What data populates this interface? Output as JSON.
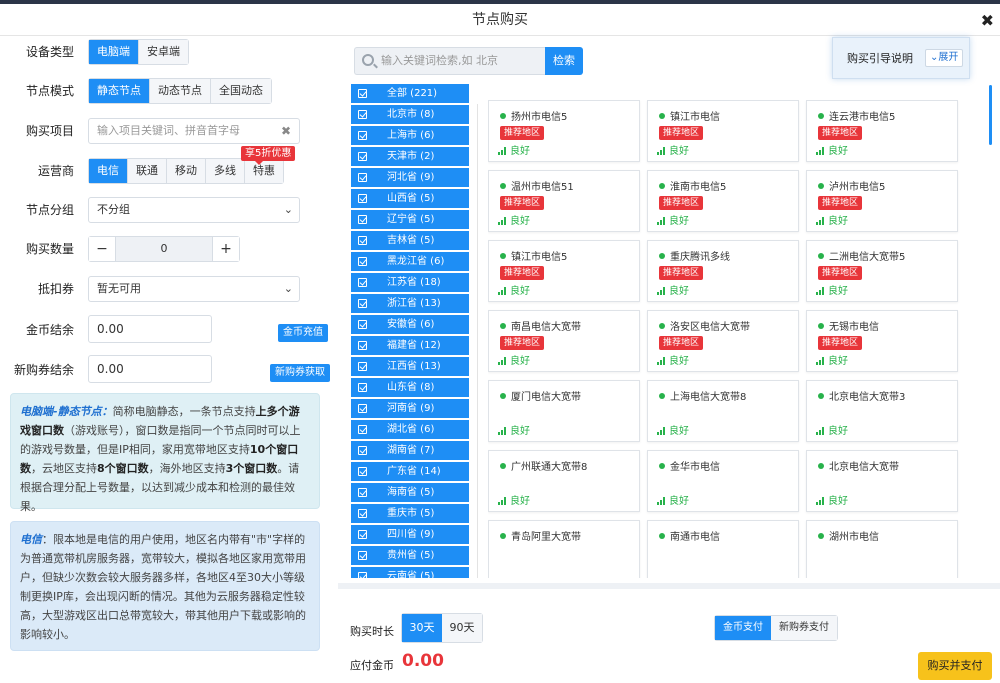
{
  "window": {
    "title": "节点购买"
  },
  "form": {
    "device": {
      "label": "设备类型",
      "options": [
        "电脑端",
        "安卓端"
      ],
      "selected": 0
    },
    "mode": {
      "label": "节点模式",
      "options": [
        "静态节点",
        "动态节点",
        "全国动态"
      ],
      "selected": 0
    },
    "project": {
      "label": "购买项目",
      "placeholder": "输入项目关键词、拼音首字母"
    },
    "carrier": {
      "label": "运营商",
      "options": [
        "电信",
        "联通",
        "移动",
        "多线",
        "特惠"
      ],
      "selected": 0,
      "promo_badge": "享5折优惠"
    },
    "group": {
      "label": "节点分组",
      "value": "不分组"
    },
    "quantity": {
      "label": "购买数量",
      "value": "0",
      "minus": "−",
      "plus": "+"
    },
    "voucher": {
      "label": "抵扣券",
      "value": "暂无可用"
    },
    "coin": {
      "label": "金币结余",
      "value": "0.00",
      "button": "金币充值"
    },
    "newvoucher": {
      "label": "新购券结余",
      "value": "0.00",
      "button": "新购券获取"
    }
  },
  "info": {
    "static": {
      "title": "电脑端-静态节点：",
      "p1": "简称电脑静态，一条节点支持",
      "h1": "上多个游戏窗口数",
      "p2": "（游戏账号），窗口数是指同一个节点同时可以上的游戏号数量，但是IP相同，家用宽带地区支持",
      "h2": "10个窗口数",
      "p3": "，云地区支持",
      "h3": "8个窗口数",
      "p4": "，海外地区支持",
      "h4": "3个窗口数",
      "p5": "。请根据合理分配上号数量，以达到减少成本和检测的最佳效果。"
    },
    "telecom": {
      "title": "电信",
      "text": "：限本地是电信的用户使用，地区名内带有\"市\"字样的为普通宽带机房服务器，宽带较大，模拟各地区家用宽带用户，但缺少次数会较大服务器多样，各地区4至30大小等级制更换IP库，会出现闪断的情况。其他为云服务器稳定性较高，大型游戏区出口总带宽较大，带其他用户下载或影响的影响较小。"
    }
  },
  "search": {
    "placeholder": "输入关键词检索,如 北京",
    "button": "检索"
  },
  "guide": {
    "label": "购买引导说明",
    "toggle": "展开"
  },
  "provinces": [
    "全部 (221)",
    "北京市 (8)",
    "上海市 (6)",
    "天津市 (2)",
    "河北省 (9)",
    "山西省 (5)",
    "辽宁省 (5)",
    "吉林省 (5)",
    "黑龙江省 (6)",
    "江苏省 (18)",
    "浙江省 (13)",
    "安徽省 (6)",
    "福建省 (12)",
    "江西省 (13)",
    "山东省 (8)",
    "河南省 (9)",
    "湖北省 (6)",
    "湖南省 (7)",
    "广东省 (14)",
    "海南省 (5)",
    "重庆市 (5)",
    "四川省 (9)",
    "贵州省 (5)",
    "云南省 (5)"
  ],
  "nodes": [
    {
      "name": "扬州市电信5",
      "tag": "推荐地区",
      "status": "良好"
    },
    {
      "name": "镇江市电信",
      "tag": "推荐地区",
      "status": "良好"
    },
    {
      "name": "连云港市电信5",
      "tag": "推荐地区",
      "status": "良好"
    },
    {
      "name": "温州市电信51",
      "tag": "推荐地区",
      "status": "良好"
    },
    {
      "name": "淮南市电信5",
      "tag": "推荐地区",
      "status": "良好"
    },
    {
      "name": "泸州市电信5",
      "tag": "推荐地区",
      "status": "良好"
    },
    {
      "name": "镇江市电信5",
      "tag": "推荐地区",
      "status": "良好"
    },
    {
      "name": "重庆腾讯多线",
      "tag": "推荐地区",
      "status": "良好"
    },
    {
      "name": "二洲电信大宽带5",
      "tag": "推荐地区",
      "status": "良好"
    },
    {
      "name": "南昌电信大宽带",
      "tag": "推荐地区",
      "status": "良好"
    },
    {
      "name": "洛安区电信大宽带",
      "tag": "推荐地区",
      "status": "良好"
    },
    {
      "name": "无锡市电信",
      "tag": "推荐地区",
      "status": "良好"
    },
    {
      "name": "厦门电信大宽带",
      "tag": "",
      "status": "良好"
    },
    {
      "name": "上海电信大宽带8",
      "tag": "",
      "status": "良好"
    },
    {
      "name": "北京电信大宽带3",
      "tag": "",
      "status": "良好"
    },
    {
      "name": "广州联通大宽带8",
      "tag": "",
      "status": "良好"
    },
    {
      "name": "金华市电信",
      "tag": "",
      "status": "良好"
    },
    {
      "name": "北京电信大宽带",
      "tag": "",
      "status": "良好"
    },
    {
      "name": "青岛阿里大宽带",
      "tag": "",
      "status": ""
    },
    {
      "name": "南通市电信",
      "tag": "",
      "status": ""
    },
    {
      "name": "湖州市电信",
      "tag": "",
      "status": ""
    }
  ],
  "footer": {
    "duration_label": "购买时长",
    "durations": [
      "30天",
      "90天"
    ],
    "duration_selected": 0,
    "pay_options": [
      "金币支付",
      "新购券支付"
    ],
    "pay_selected": 0,
    "amount_label": "应付金币",
    "amount": "0.00",
    "buy_button": "购买并支付"
  },
  "colors": {
    "accent": "#1e8ef5",
    "recommend": "#e8353a",
    "good": "#28b24b",
    "buy": "#f7c21b"
  }
}
